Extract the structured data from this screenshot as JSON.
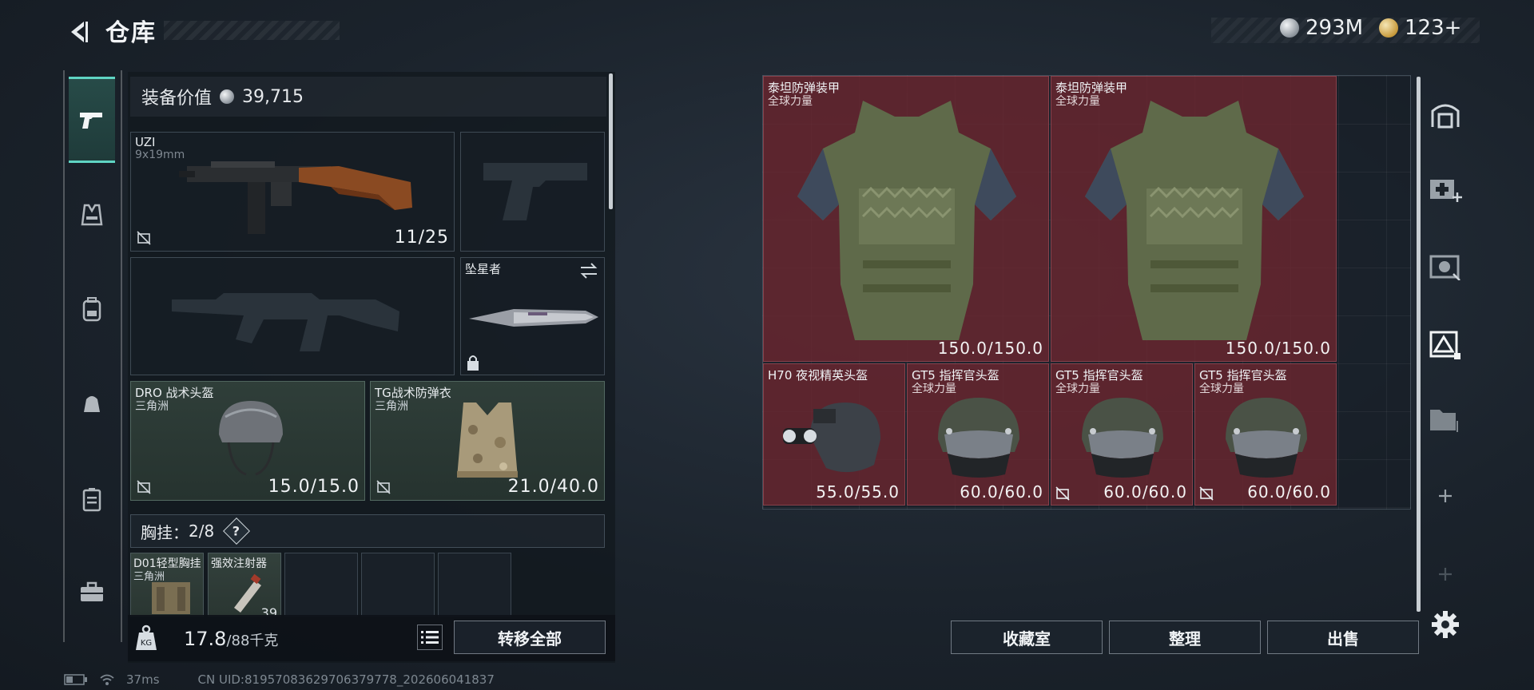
{
  "header": {
    "title": "仓库",
    "currency_silver": "293M",
    "currency_gold": "123+"
  },
  "equipment": {
    "value_label": "装备价值",
    "value": "39,715",
    "primary_weapon": {
      "name": "UZI",
      "caliber": "9x19mm",
      "ammo": "11/25"
    },
    "melee": {
      "name": "坠星者"
    },
    "helmet": {
      "name": "DRO 战术头盔",
      "origin": "三角洲",
      "durability": "15.0/15.0"
    },
    "armor": {
      "name": "TG战术防弹衣",
      "origin": "三角洲",
      "durability": "21.0/40.0"
    },
    "chest_rig": {
      "label": "胸挂：",
      "capacity": "2/8",
      "help": "?",
      "items": [
        {
          "name": "D01轻型胸挂",
          "origin": "三角洲"
        },
        {
          "name": "强效注射器",
          "count": "39"
        }
      ]
    }
  },
  "bottom_left": {
    "weight": "17.8",
    "weight_cap": "/88千克",
    "transfer_all": "转移全部"
  },
  "stash": {
    "items": [
      {
        "name": "泰坦防弹装甲",
        "sub": "全球力量",
        "value": "150.0/150.0"
      },
      {
        "name": "泰坦防弹装甲",
        "sub": "全球力量",
        "value": "150.0/150.0"
      },
      {
        "name": "H70 夜视精英头盔",
        "sub": "",
        "value": "55.0/55.0"
      },
      {
        "name": "GT5 指挥官头盔",
        "sub": "全球力量",
        "value": "60.0/60.0"
      },
      {
        "name": "GT5 指挥官头盔",
        "sub": "全球力量",
        "value": "60.0/60.0"
      },
      {
        "name": "GT5 指挥官头盔",
        "sub": "全球力量",
        "value": "60.0/60.0"
      }
    ]
  },
  "buttons": {
    "collection": "收藏室",
    "organize": "整理",
    "sell": "出售"
  },
  "status": {
    "ping": "37ms",
    "uid": "CN UID:81957083629706379778_202606041837"
  },
  "colors": {
    "accent": "#5fd4c3",
    "stash_item_bg": "#6e2630",
    "equip_green": "#2f3e39"
  }
}
